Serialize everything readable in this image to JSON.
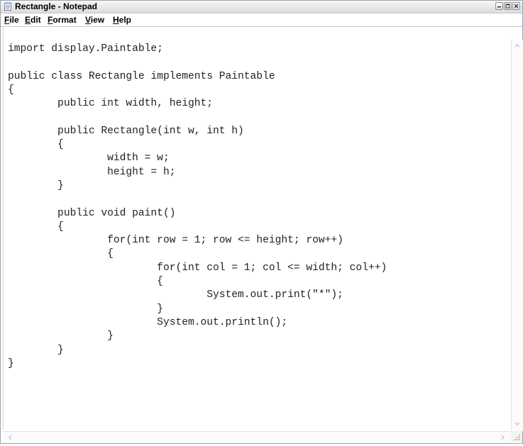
{
  "window": {
    "title": "Rectangle - Notepad",
    "icons": {
      "app": "notepad-icon",
      "minimize": "minimize-icon",
      "maximize": "maximize-icon",
      "close": "close-icon"
    }
  },
  "menu": {
    "file": "File",
    "edit": "Edit",
    "format": "Format",
    "view": "View",
    "help": "Help"
  },
  "editor": {
    "content": "import display.Paintable;\n\npublic class Rectangle implements Paintable\n{\n        public int width, height;\n\n        public Rectangle(int w, int h)\n        {\n                width = w;\n                height = h;\n        }\n\n        public void paint()\n        {\n                for(int row = 1; row <= height; row++)\n                {\n                        for(int col = 1; col <= width; col++)\n                        {\n                                System.out.print(\"*\");\n                        }\n                        System.out.println();\n                }\n        }\n}"
  },
  "colors": {
    "titlebar": "#dcdcdc",
    "text": "#222222",
    "background": "#ffffff"
  }
}
